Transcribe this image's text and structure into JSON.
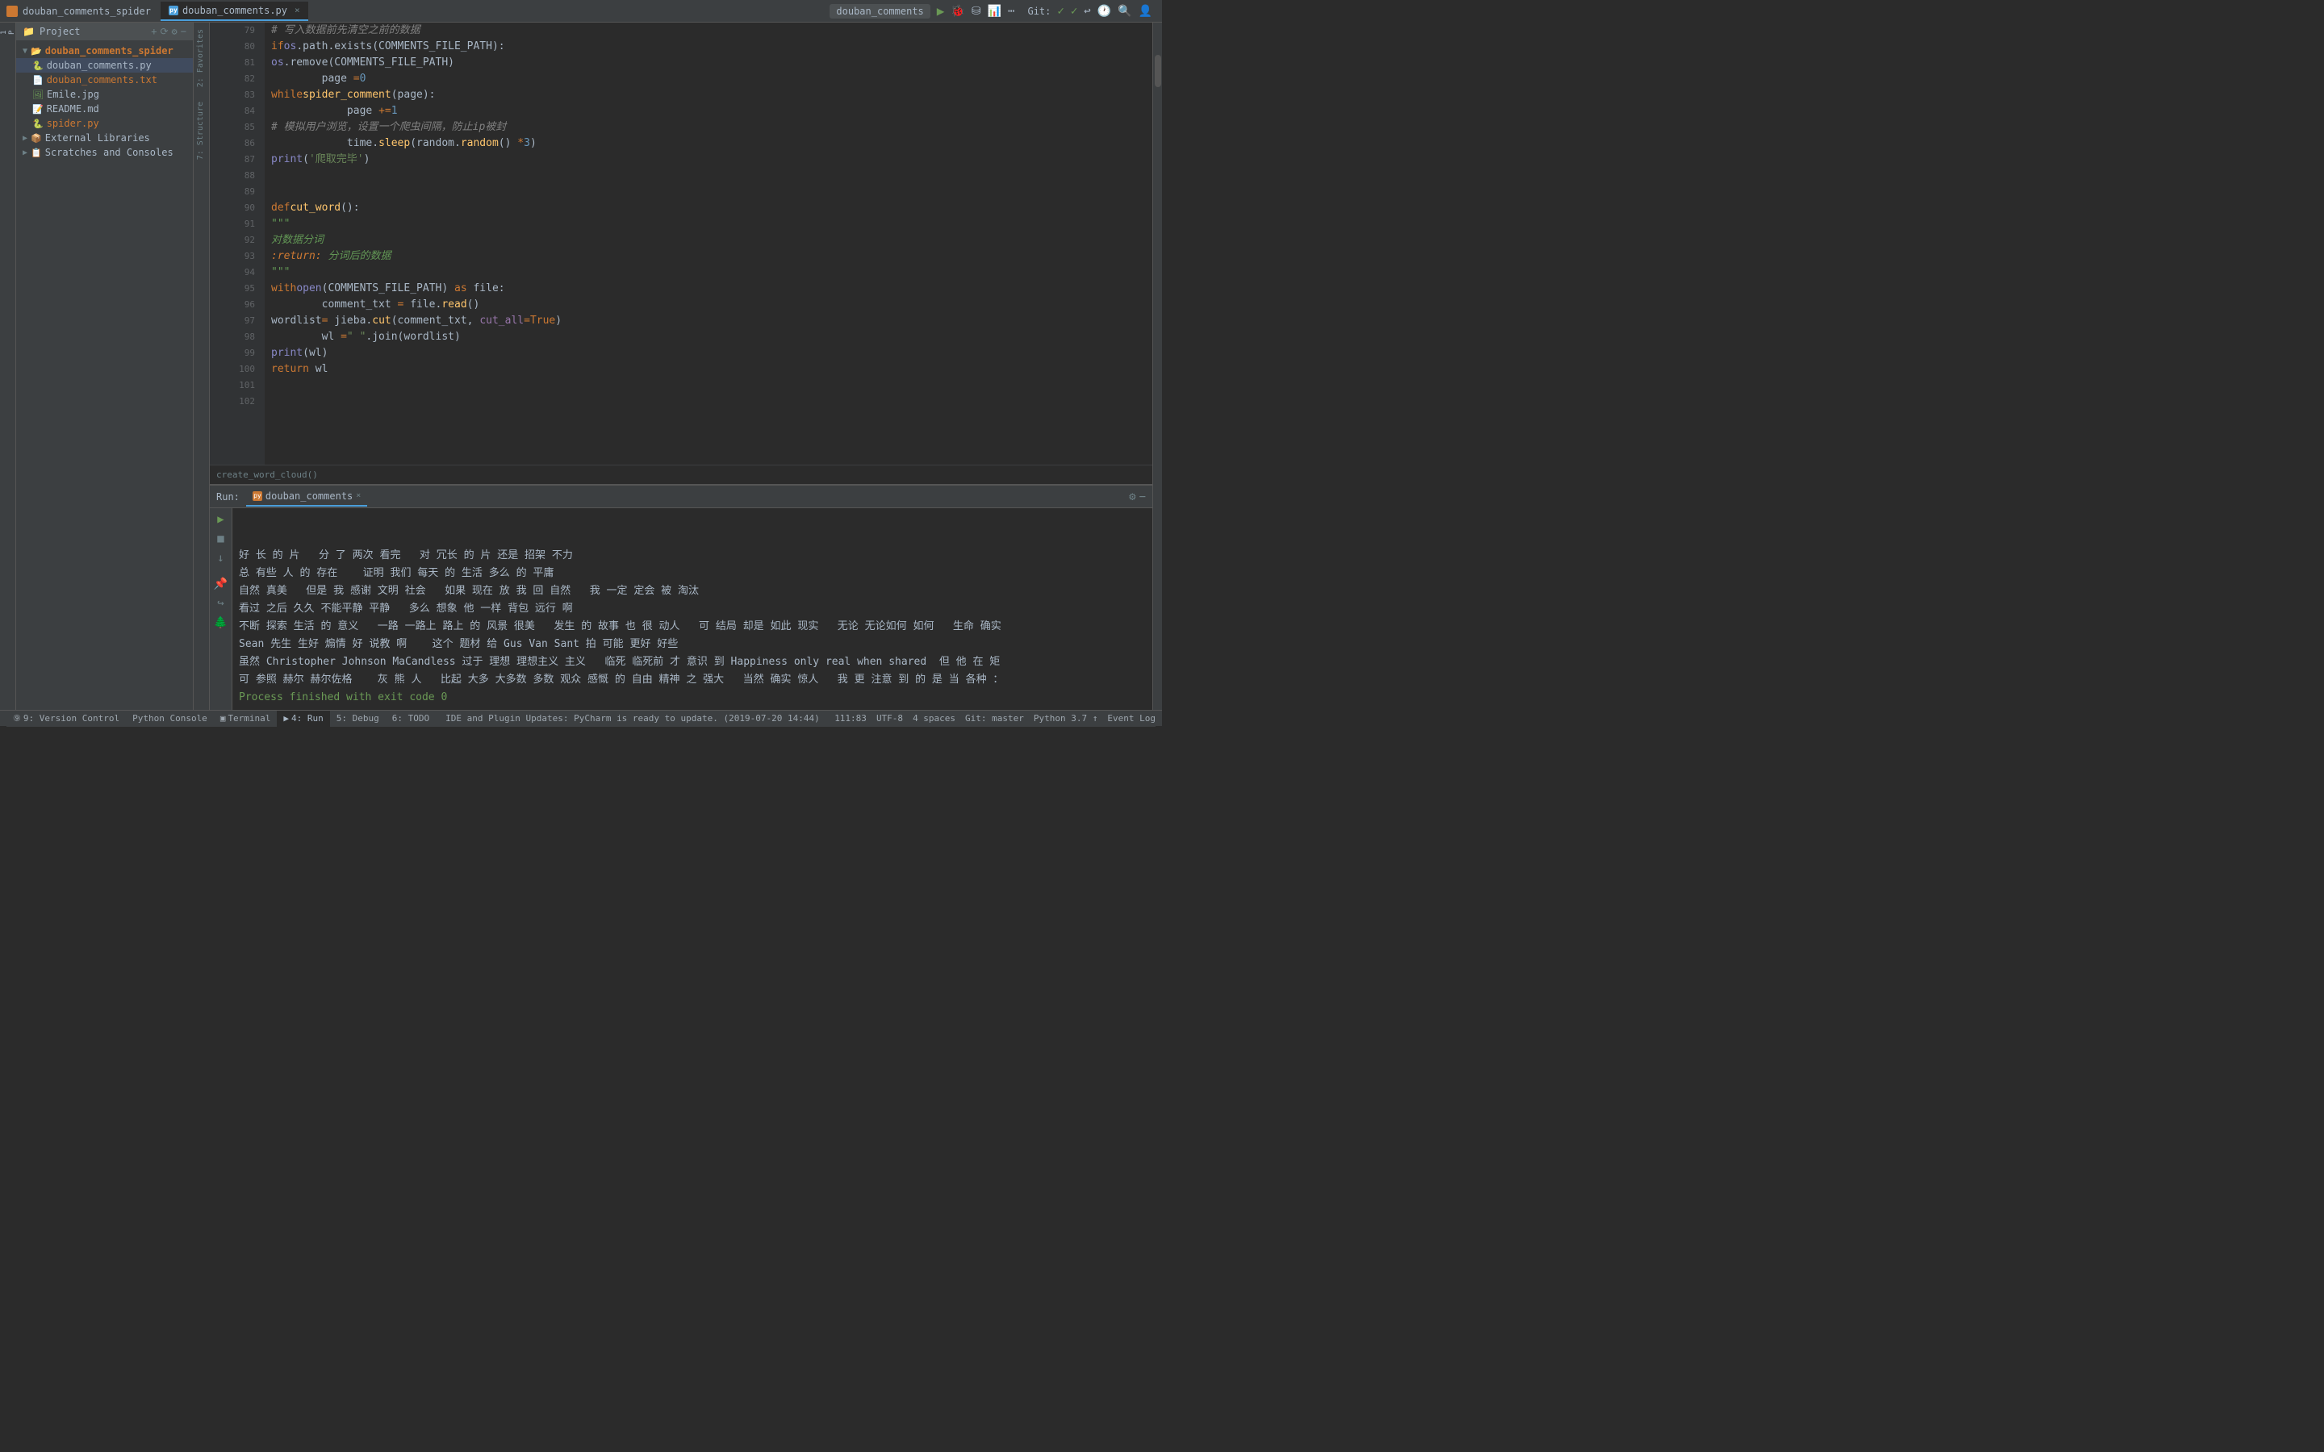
{
  "titlebar": {
    "app_name": "douban_comments_spider",
    "file_tab": "douban_comments.py",
    "run_profile": "douban_comments",
    "git_label": "Git:"
  },
  "project": {
    "header": "Project",
    "root": "douban_comments_spider",
    "files": [
      {
        "name": "douban_comments.py",
        "type": "py",
        "indent": 1
      },
      {
        "name": "douban_comments.txt",
        "type": "txt",
        "indent": 1
      },
      {
        "name": "Emile.jpg",
        "type": "jpg",
        "indent": 1
      },
      {
        "name": "README.md",
        "type": "md",
        "indent": 1
      },
      {
        "name": "spider.py",
        "type": "py",
        "indent": 1
      },
      {
        "name": "External Libraries",
        "type": "folder",
        "indent": 0
      },
      {
        "name": "Scratches and Consoles",
        "type": "folder",
        "indent": 0
      }
    ]
  },
  "editor": {
    "filename": "douban_comments.py",
    "breadcrumb": "create_word_cloud()"
  },
  "code_lines": [
    {
      "num": 79,
      "content": ""
    },
    {
      "num": 80,
      "content": "        if os.path.exists(COMMENTS_FILE_PATH):"
    },
    {
      "num": 81,
      "content": "            os.remove(COMMENTS_FILE_PATH)"
    },
    {
      "num": 82,
      "content": "        page = 0"
    },
    {
      "num": 83,
      "content": "        while spider_comment(page):"
    },
    {
      "num": 84,
      "content": "            page += 1"
    },
    {
      "num": 85,
      "content": "            # 模拟用户浏览，设置一个爬虫间隔，防止ip被封"
    },
    {
      "num": 86,
      "content": "            time.sleep(random.random() * 3)"
    },
    {
      "num": 87,
      "content": "        print('爬取完毕')"
    },
    {
      "num": 88,
      "content": ""
    },
    {
      "num": 89,
      "content": ""
    },
    {
      "num": 90,
      "content": "def cut_word():"
    },
    {
      "num": 91,
      "content": "    \"\"\""
    },
    {
      "num": 92,
      "content": "    对数据分词"
    },
    {
      "num": 93,
      "content": "    :return: 分词后的数据"
    },
    {
      "num": 94,
      "content": "    \"\"\""
    },
    {
      "num": 95,
      "content": "    with open(COMMENTS_FILE_PATH) as file:"
    },
    {
      "num": 96,
      "content": "        comment_txt = file.read()"
    },
    {
      "num": 97,
      "content": "        wordlist = jieba.cut(comment_txt, cut_all=True)"
    },
    {
      "num": 98,
      "content": "        wl = \" \".join(wordlist)"
    },
    {
      "num": 99,
      "content": "        print(wl)"
    },
    {
      "num": 100,
      "content": "        return wl"
    },
    {
      "num": 101,
      "content": ""
    },
    {
      "num": 102,
      "content": ""
    }
  ],
  "run_panel": {
    "label": "Run:",
    "tab_name": "douban_comments",
    "output_lines": [
      "好 长 的 片   分 了 两次 看完   对 冗长 的 片 还是 招架 不力",
      "总 有些 人 的 存在    证明 我们 每天 的 生活 多么 的 平庸",
      "自然 真美   但是 我 感谢 文明 社会   如果 现在 放 我 回 自然   我 一定 定会 被 淘汰",
      "看过 之后 久久 不能平静 平静   多么 想象 他 一样 背包 远行 啊",
      "不断 探索 生活 的 意义   一路 一路上 路上 的 风景 很美   发生 的 故事 也 很 动人   可 结局 却是 如此 现实   无论 无论如何 如何   生命 确实",
      "Sean 先生 生好 煽情 好 说教 啊    这个 题材 给 Gus Van Sant 拍 可能 更好 好些",
      "虽然 Christopher Johnson MaCandless 过于 理想 理想主义 主义   临死 临死前 才 意识 到 Happiness only real when shared  但 他 在 矩",
      "可 参照 赫尔 赫尔佐格    灰 熊 人   比起 大多 大多数 多数 观众 感慨 的 自由 精神 之 强大   当然 确实 惊人   我 更 注意 到 的 是 当 各种 ："
    ],
    "process_line": "Process finished with exit code 0"
  },
  "status_bar": {
    "version_control": "9: Version Control",
    "python_console": "Python Console",
    "terminal": "Terminal",
    "run": "4: Run",
    "debug": "5: Debug",
    "todo": "6: TODO",
    "event_log": "Event Log",
    "cursor": "111:83",
    "encoding": "UTF-8",
    "indent": "4 spaces",
    "git": "Git: master",
    "python": "Python 3.7 ↑",
    "message": "IDE and Plugin Updates: PyCharm is ready to update. (2019-07-20 14:44)"
  }
}
